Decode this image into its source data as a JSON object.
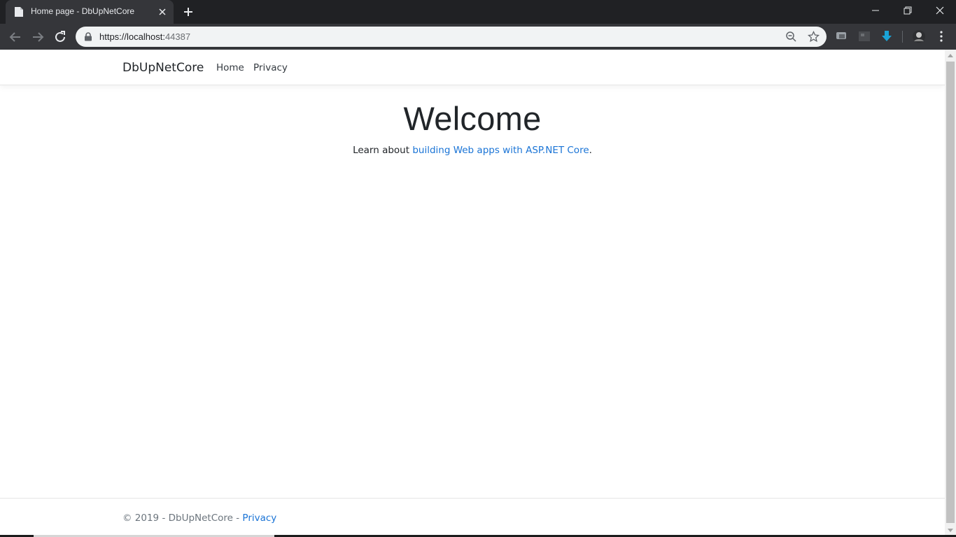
{
  "browser": {
    "tab_title": "Home page - DbUpNetCore",
    "url_host": "https://localhost:",
    "url_port": "44387"
  },
  "navbar": {
    "brand": "DbUpNetCore",
    "links": [
      "Home",
      "Privacy"
    ]
  },
  "main": {
    "heading": "Welcome",
    "lead_prefix": "Learn about ",
    "lead_link": "building Web apps with ASP.NET Core",
    "lead_suffix": "."
  },
  "footer": {
    "text": "© 2019 - DbUpNetCore - ",
    "link": "Privacy"
  },
  "colors": {
    "link": "#1a74d6",
    "chrome_dark": "#202124",
    "toolbar": "#35363a",
    "download_icon": "#1aa3d6"
  }
}
